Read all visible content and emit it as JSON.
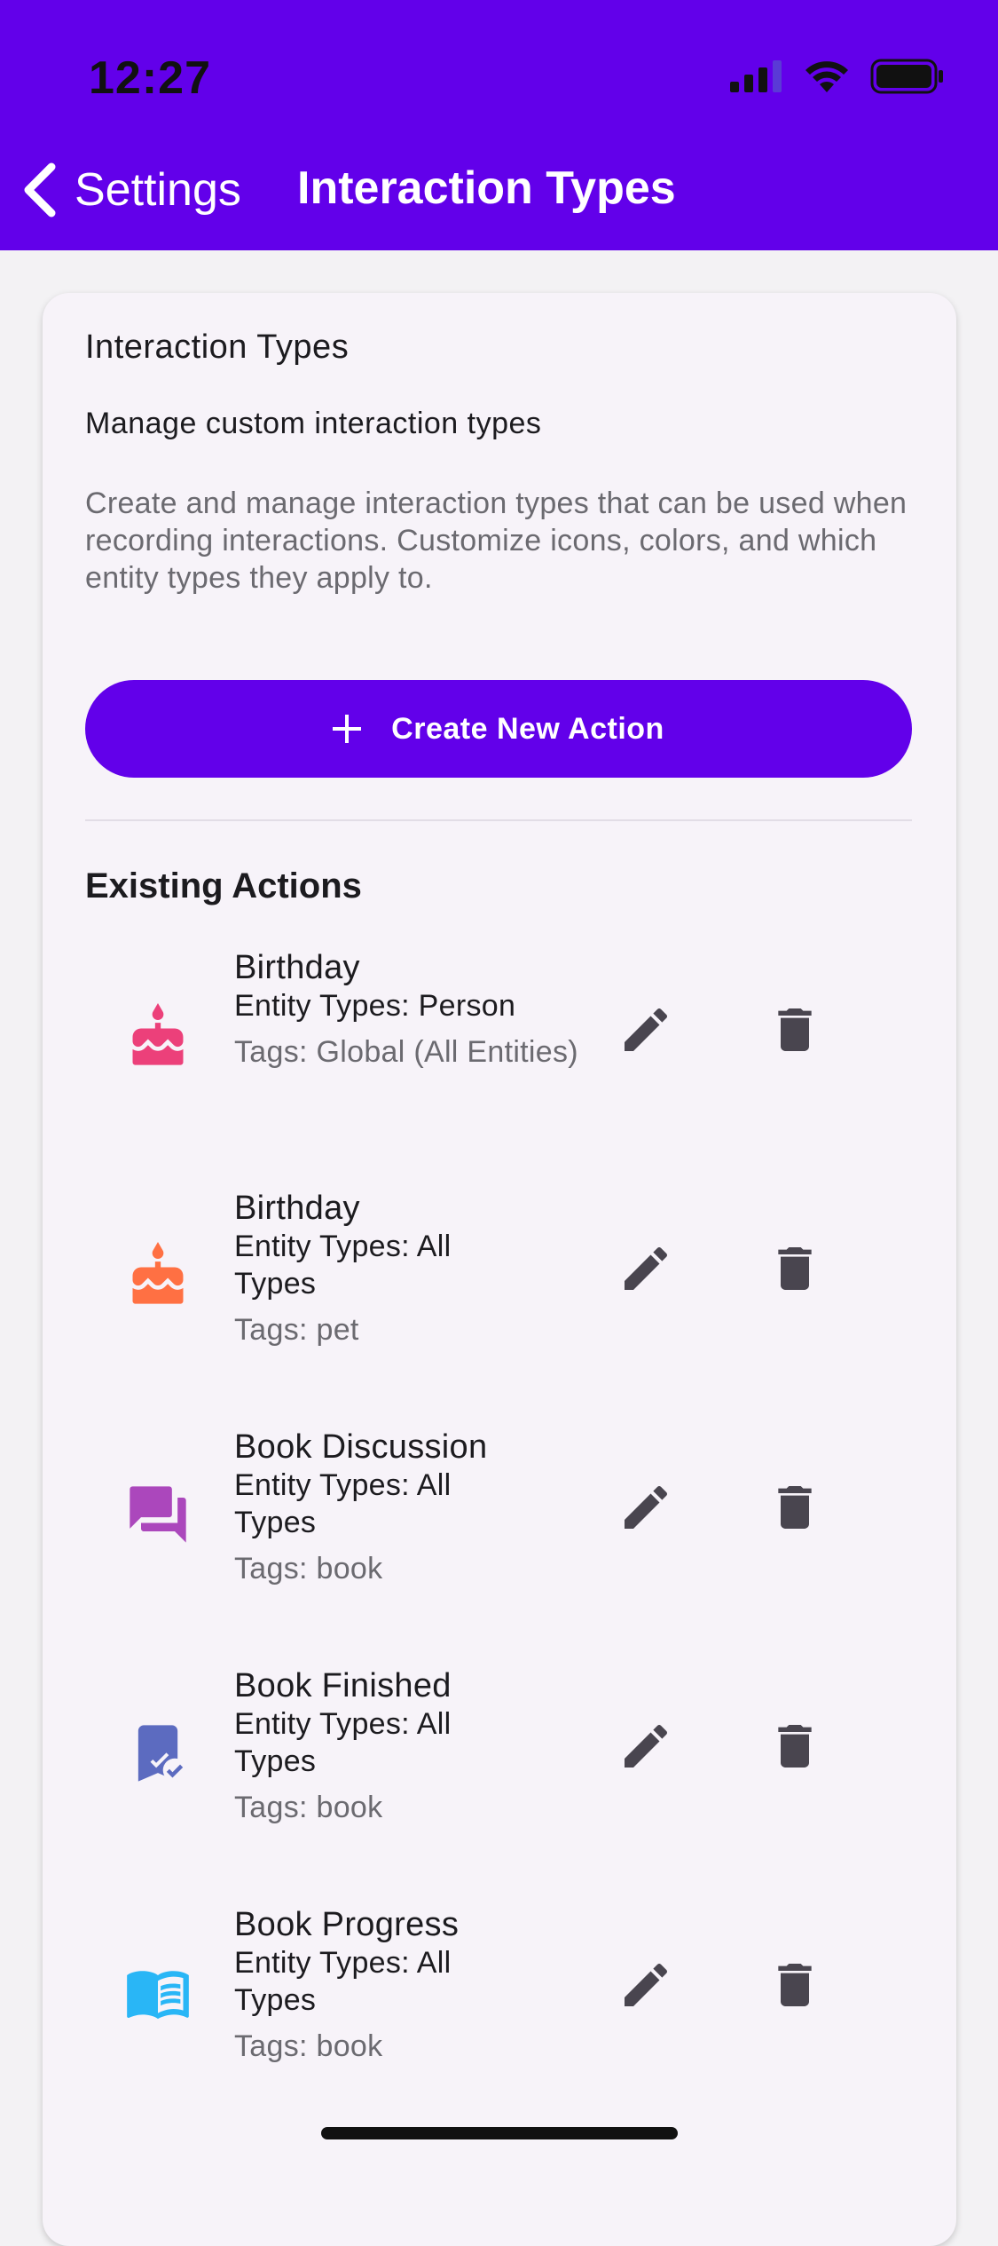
{
  "status_bar": {
    "time": "12:27"
  },
  "nav": {
    "back_label": "Settings",
    "title": "Interaction Types"
  },
  "card": {
    "title": "Interaction Types",
    "subtitle": "Manage custom interaction types",
    "description": "Create and manage interaction types that can be used when recording interactions. Customize icons, colors, and which entity types they apply to.",
    "create_button_label": "Create New Action",
    "section_title": "Existing Actions"
  },
  "actions": [
    {
      "name": "Birthday",
      "entity_types": "Entity Types: Person",
      "tags": "Tags: Global (All Entities)",
      "icon": "cake-icon",
      "color": "#ec407a"
    },
    {
      "name": "Birthday",
      "entity_types": "Entity Types: All Types",
      "tags": "Tags: pet",
      "icon": "cake-icon",
      "color": "#ff7043"
    },
    {
      "name": "Book Discussion",
      "entity_types": "Entity Types: All Types",
      "tags": "Tags: book",
      "icon": "forum-icon",
      "color": "#ab47bc"
    },
    {
      "name": "Book Finished",
      "entity_types": "Entity Types: All Types",
      "tags": "Tags: book",
      "icon": "bookmark-check-icon",
      "color": "#5c6bc0"
    },
    {
      "name": "Book Progress",
      "entity_types": "Entity Types: All Types",
      "tags": "Tags: book",
      "icon": "menu-book-icon",
      "color": "#29b6f6"
    }
  ],
  "colors": {
    "primary": "#6200ea",
    "icon_gray": "#49454f",
    "card_bg": "#f7f3f9"
  }
}
